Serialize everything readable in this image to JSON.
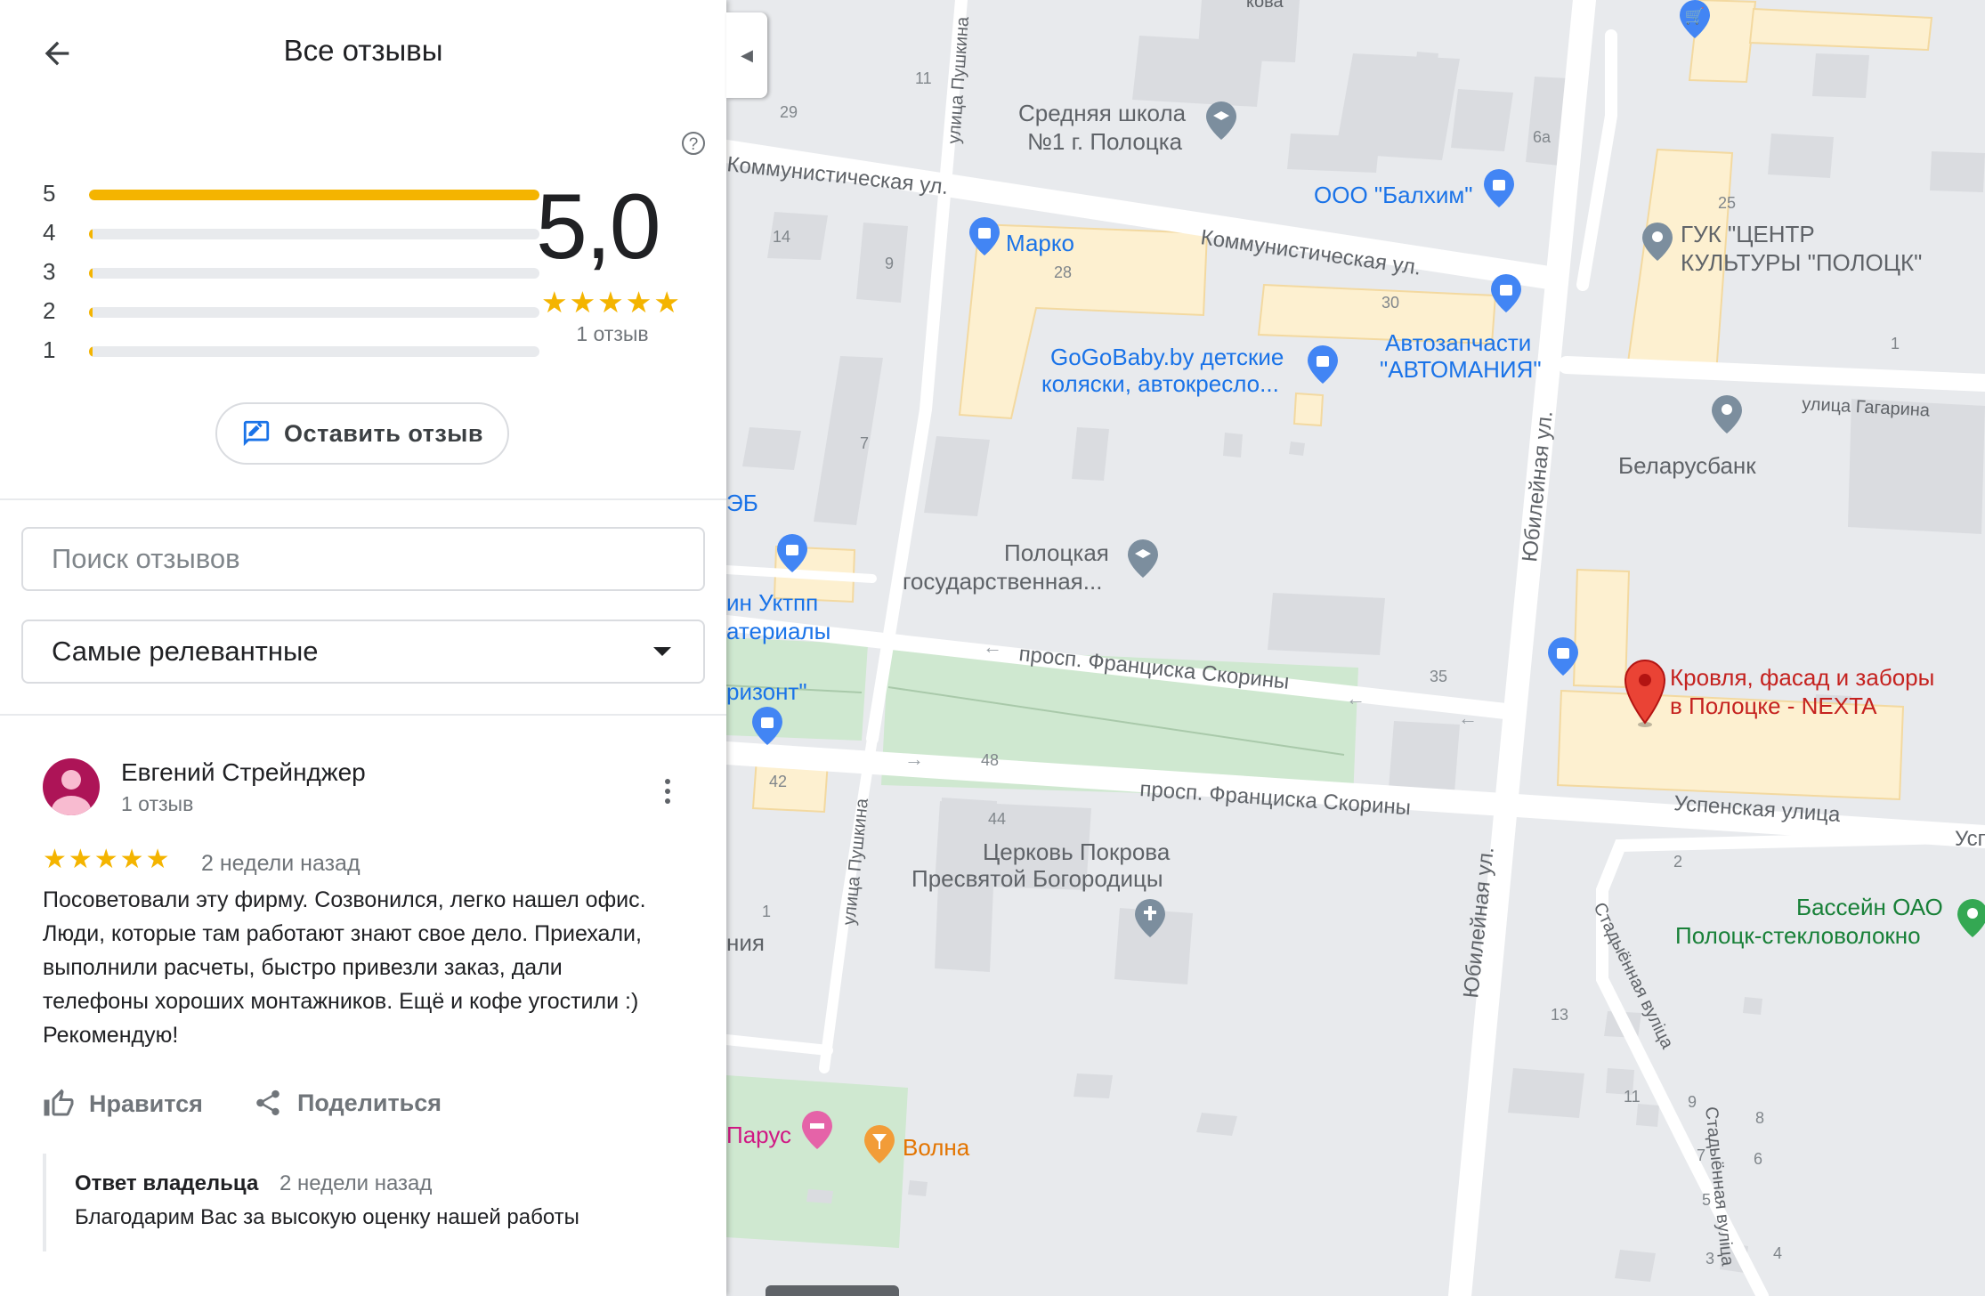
{
  "panel": {
    "title": "Все отзывы",
    "back_icon": "arrow-left-icon",
    "help_label": "?",
    "histogram": [
      {
        "stars": "5",
        "fraction": 1.0
      },
      {
        "stars": "4",
        "fraction": 0.0
      },
      {
        "stars": "3",
        "fraction": 0.0
      },
      {
        "stars": "2",
        "fraction": 0.0
      },
      {
        "stars": "1",
        "fraction": 0.0
      }
    ],
    "average_score": "5,0",
    "average_stars": "★★★★★",
    "review_count": "1 отзыв",
    "write_review_label": "Оставить отзыв",
    "search_placeholder": "Поиск отзывов",
    "sort_label": "Самые релевантные",
    "review": {
      "author": "Евгений Стрейнджер",
      "author_reviews": "1 отзыв",
      "stars": "★★★★★",
      "rating": 5,
      "date": "2 недели назад",
      "text": "Посоветовали эту фирму. Созвонился, легко нашел офис.\nЛюди, которые там работают знают свое дело. Приехали,\nвыполнили расчеты, быстро привезли заказ, дали\nтелефоны хороших монтажников. Ещё и кофе угостили :)\nРекомендую!",
      "like_label": "Нравится",
      "share_label": "Поделиться",
      "owner_reply": {
        "title": "Ответ владельца",
        "date": "2 недели назад",
        "text": "Благодарим Вас за высокую оценку нашей работы"
      }
    },
    "accent_color": "#f4b400"
  },
  "map": {
    "streets": {
      "kommunisticheskaya_1": "Коммунистическая ул.",
      "kommunisticheskaya_2": "Коммунистическая ул.",
      "pushkina_1": "улица Пушкина",
      "pushkina_2": "улица Пушкина",
      "skoriny_1": "просп. Франциска Скорины",
      "skoriny_2": "просп. Франциска Скорины",
      "yubileynaya_1": "Юбилейная ул.",
      "yubileynaya_2": "Юбилейная ул.",
      "gagarina": "улица Гагарина",
      "uspenskaya": "Успенская улица",
      "uspenskaya_cut": "Усп",
      "stadionnaya_1": "Стадыённая вуліца",
      "stadionnaya_2": "Стадыённая вуліца",
      "top_cut": "кова"
    },
    "places": {
      "school_1": "Средняя школа",
      "school_2": "№1 г. Полоцка",
      "balkhim": "ООО \"Балхим\"",
      "marko": "Марко",
      "gogobaby_1": "GoGoBaby.by детские",
      "gogobaby_2": "коляски, автокресло...",
      "avto_1": "Автозапчасти",
      "avto_2": "\"АВТОМАНИЯ\"",
      "guk_1": "ГУК \"ЦЕНТР",
      "guk_2": "КУЛЬТУРЫ \"ПОЛОЦК\"",
      "belarusbank": "Беларусбанк",
      "university_1": "Полоцкая",
      "university_2": "государственная...",
      "ukt_1": "ин Уктпп",
      "ukt_2": "атериалы",
      "eb": "ЭБ",
      "horizont": "ризонт\"",
      "church_1": "Церковь Покрова",
      "church_2": "Пресвятой Богородицы",
      "pool_1": "Бассейн ОАО",
      "pool_2": "Полоцк-стекловолокно",
      "parus": "Парус",
      "volna": "Волна",
      "nia": "ния",
      "nexta_1": "Кровля, фасад и заборы",
      "nexta_2": "в Полоцке - NEXTA"
    },
    "numbers": {
      "n11": "11",
      "n29": "29",
      "n6a": "6а",
      "n14": "14",
      "n9": "9",
      "n28": "28",
      "n30": "30",
      "n25": "25",
      "n1a": "1",
      "n7": "7",
      "n35": "35",
      "n48": "48",
      "n42": "42",
      "n44": "44",
      "n1b": "1",
      "n2": "2",
      "n13": "13",
      "n11b": "11",
      "n9b": "9",
      "n8": "8",
      "n7b": "7",
      "n6": "6",
      "n5": "5",
      "n3": "3",
      "n4": "4"
    }
  }
}
